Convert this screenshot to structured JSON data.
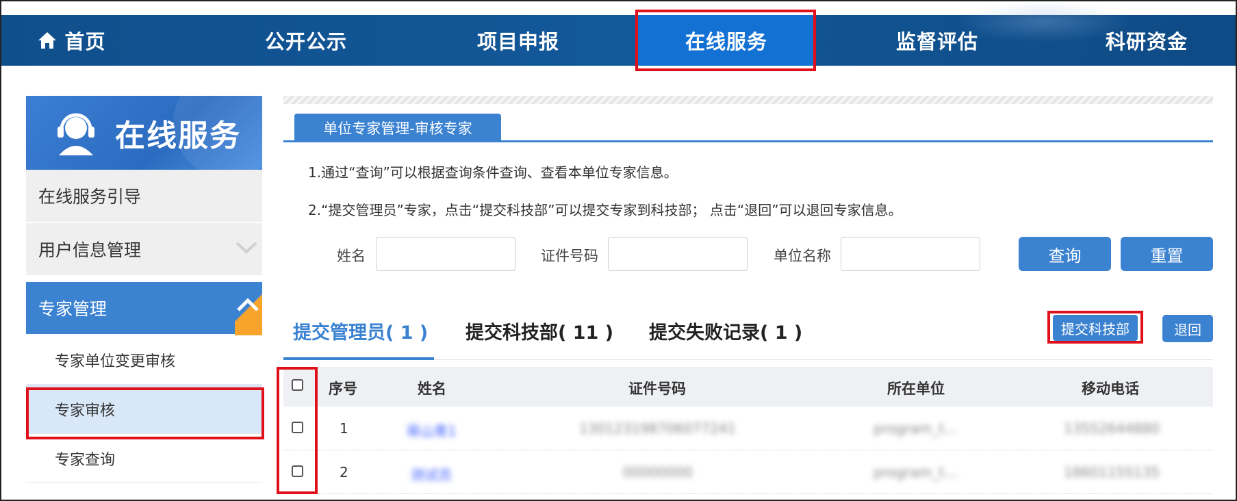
{
  "topnav": {
    "items": [
      {
        "label": "首页",
        "icon": "home-icon"
      },
      {
        "label": "公开公示"
      },
      {
        "label": "项目申报"
      },
      {
        "label": "在线服务",
        "active": true
      },
      {
        "label": "监督评估"
      },
      {
        "label": "科研资金"
      }
    ]
  },
  "sidebar": {
    "banner_title": "在线服务",
    "banner_icon": "customer-service-icon",
    "items": [
      {
        "label": "在线服务引导"
      },
      {
        "label": "用户信息管理",
        "icon": "chevron-down-icon"
      },
      {
        "label": "专家管理",
        "icon": "chevron-up-icon",
        "expanded": true
      }
    ],
    "sub_items": [
      {
        "label": "专家单位变更审核"
      },
      {
        "label": "专家审核",
        "selected": true
      },
      {
        "label": "专家查询"
      }
    ]
  },
  "main": {
    "tab_label": "单位专家管理-审核专家",
    "instructions": [
      "1.通过“查询”可以根据查询条件查询、查看本单位专家信息。",
      "2.“提交管理员”专家，点击“提交科技部”可以提交专家到科技部；  点击“退回”可以退回专家信息。"
    ],
    "search": {
      "name_label": "姓名",
      "id_label": "证件号码",
      "unit_label": "单位名称",
      "name_value": "",
      "id_value": "",
      "unit_value": "",
      "query_button": "查询",
      "reset_button": "重置"
    },
    "subtabs": [
      {
        "label": "提交管理员( 1 )",
        "active": true
      },
      {
        "label": "提交科技部( 11 )"
      },
      {
        "label": "提交失败记录( 1 )"
      }
    ],
    "actions": {
      "submit_label": "提交科技部",
      "return_label": "退回"
    },
    "table": {
      "columns": [
        "序号",
        "姓名",
        "证件号码",
        "所在单位",
        "移动电话"
      ],
      "rows": [
        {
          "index": "1",
          "name": "蒋山青1",
          "id_number": "130123198706077241",
          "unit": "program_t...",
          "phone": "13552644880"
        },
        {
          "index": "2",
          "name": "测试员",
          "id_number": "00000000",
          "unit": "program_t...",
          "phone": "18601155135"
        }
      ]
    }
  },
  "colors": {
    "nav_bg": "#135899",
    "nav_active": "#1271d3",
    "accent": "#3b82d1",
    "highlight_red": "#e0101a",
    "sidebar_corner": "#f7a32c"
  }
}
